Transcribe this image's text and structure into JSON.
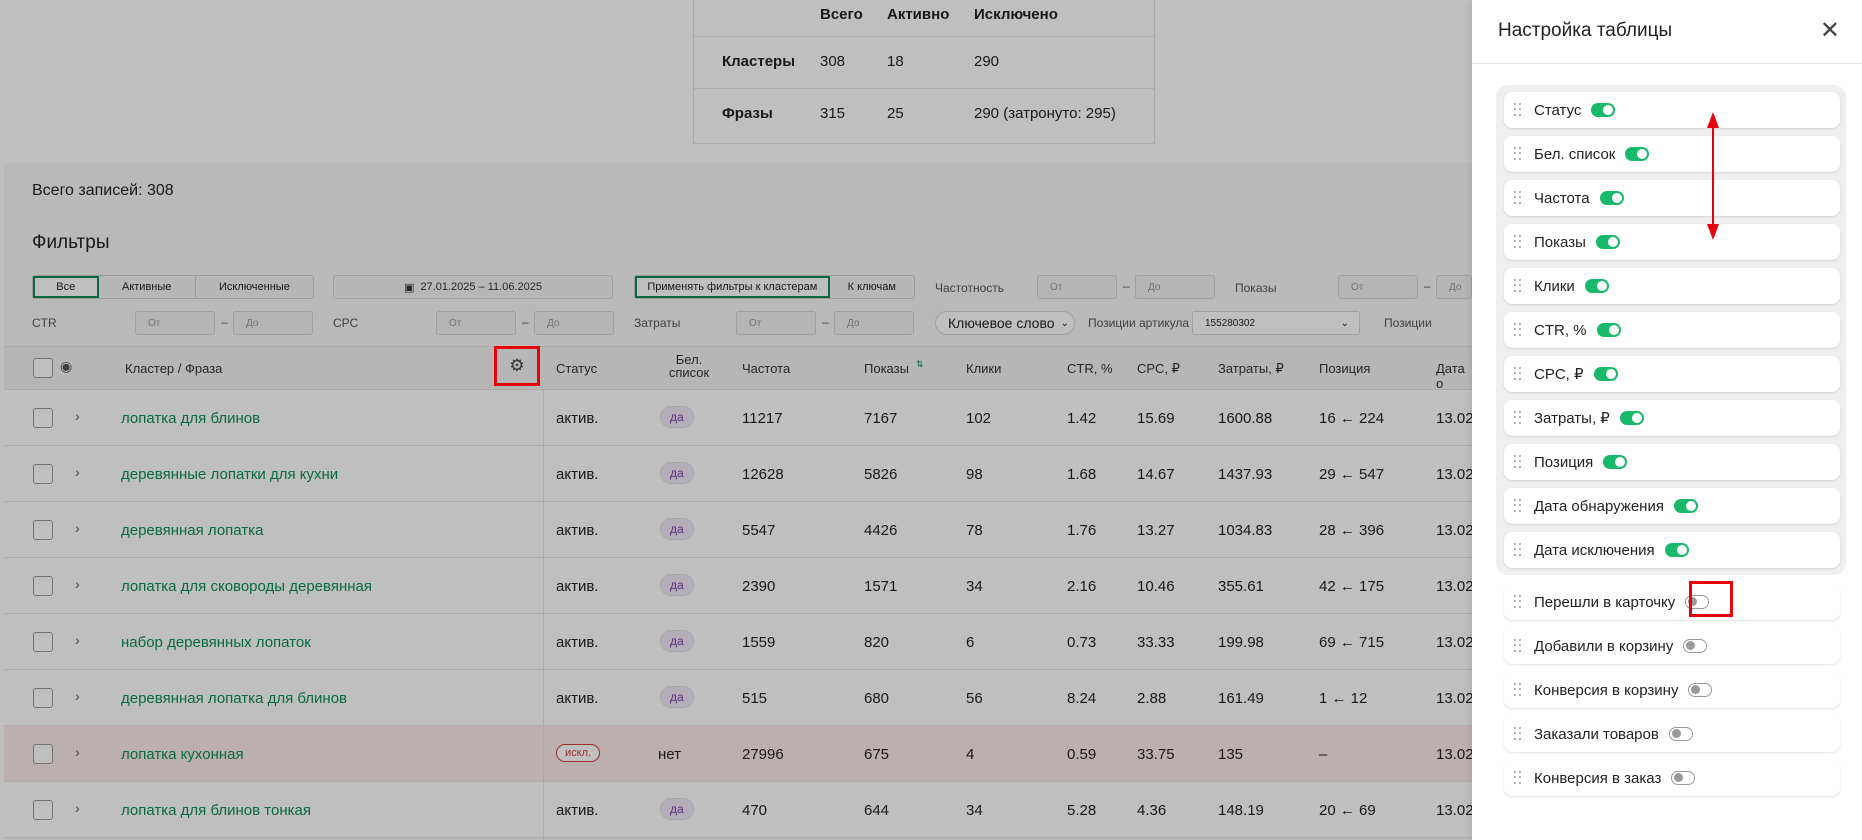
{
  "summary": {
    "headers": [
      "Всего",
      "Активно",
      "Исключено"
    ],
    "rows": [
      {
        "label": "Кластеры",
        "total": "308",
        "active": "18",
        "excluded": "290"
      },
      {
        "label": "Фразы",
        "total": "315",
        "active": "25",
        "excluded": "290 (затронуто: 295)"
      }
    ]
  },
  "records_label": "Всего записей: 308",
  "filters": {
    "title": "Фильтры",
    "status_segments": [
      "Все",
      "Активные",
      "Исключенные"
    ],
    "date_range": "27.01.2025 – 11.06.2025",
    "apply_segments": [
      "Применять фильтры к кластерам",
      "К ключам"
    ],
    "frequency_label": "Частотность",
    "shows_label": "Показы",
    "ctr_label": "CTR",
    "cpc_label": "CPC",
    "costs_label": "Затраты",
    "from_placeholder": "От",
    "to_placeholder": "До",
    "keyword_select": "Ключевое слово",
    "article_positions_label": "Позиции артикула",
    "article_value": "155280302",
    "positions_label": "Позиции"
  },
  "table": {
    "headers": {
      "cluster": "Кластер / Фраза",
      "status": "Статус",
      "whitelist": "Бел. список",
      "frequency": "Частота",
      "shows": "Показы",
      "clicks": "Клики",
      "ctr": "CTR, %",
      "cpc": "CPC, ₽",
      "costs": "Затраты, ₽",
      "position": "Позиция",
      "date": "Дата о"
    },
    "rows": [
      {
        "name": "лопатка для блинов",
        "status": "актив.",
        "white": "да",
        "freq": "11217",
        "shows": "7167",
        "clicks": "102",
        "ctr": "1.42",
        "cpc": "15.69",
        "costs": "1600.88",
        "pos": "16 ← 224",
        "date": "13.02",
        "excluded": false
      },
      {
        "name": "деревянные лопатки для кухни",
        "status": "актив.",
        "white": "да",
        "freq": "12628",
        "shows": "5826",
        "clicks": "98",
        "ctr": "1.68",
        "cpc": "14.67",
        "costs": "1437.93",
        "pos": "29 ← 547",
        "date": "13.02",
        "excluded": false
      },
      {
        "name": "деревянная лопатка",
        "status": "актив.",
        "white": "да",
        "freq": "5547",
        "shows": "4426",
        "clicks": "78",
        "ctr": "1.76",
        "cpc": "13.27",
        "costs": "1034.83",
        "pos": "28 ← 396",
        "date": "13.02",
        "excluded": false
      },
      {
        "name": "лопатка для сковороды деревянная",
        "status": "актив.",
        "white": "да",
        "freq": "2390",
        "shows": "1571",
        "clicks": "34",
        "ctr": "2.16",
        "cpc": "10.46",
        "costs": "355.61",
        "pos": "42 ← 175",
        "date": "13.02",
        "excluded": false
      },
      {
        "name": "набор деревянных лопаток",
        "status": "актив.",
        "white": "да",
        "freq": "1559",
        "shows": "820",
        "clicks": "6",
        "ctr": "0.73",
        "cpc": "33.33",
        "costs": "199.98",
        "pos": "69 ← 715",
        "date": "13.02",
        "excluded": false
      },
      {
        "name": "деревянная лопатка для блинов",
        "status": "актив.",
        "white": "да",
        "freq": "515",
        "shows": "680",
        "clicks": "56",
        "ctr": "8.24",
        "cpc": "2.88",
        "costs": "161.49",
        "pos": "1 ← 12",
        "date": "13.02",
        "excluded": false
      },
      {
        "name": "лопатка кухонная",
        "status": "искл.",
        "white": "нет",
        "freq": "27996",
        "shows": "675",
        "clicks": "4",
        "ctr": "0.59",
        "cpc": "33.75",
        "costs": "135",
        "pos": "–",
        "date": "13.02",
        "excluded": true
      },
      {
        "name": "лопатка для блинов тонкая",
        "status": "актив.",
        "white": "да",
        "freq": "470",
        "shows": "644",
        "clicks": "34",
        "ctr": "5.28",
        "cpc": "4.36",
        "costs": "148.19",
        "pos": "20 ← 69",
        "date": "13.02",
        "excluded": false
      }
    ]
  },
  "panel": {
    "title": "Настройка таблицы",
    "items": [
      {
        "label": "Статус",
        "on": true
      },
      {
        "label": "Бел. список",
        "on": true
      },
      {
        "label": "Частота",
        "on": true
      },
      {
        "label": "Показы",
        "on": true
      },
      {
        "label": "Клики",
        "on": true
      },
      {
        "label": "CTR, %",
        "on": true
      },
      {
        "label": "CPC, ₽",
        "on": true
      },
      {
        "label": "Затраты, ₽",
        "on": true
      },
      {
        "label": "Позиция",
        "on": true
      },
      {
        "label": "Дата обнаружения",
        "on": true
      },
      {
        "label": "Дата исключения",
        "on": true
      },
      {
        "label": "Перешли в карточку",
        "on": false
      },
      {
        "label": "Добавили в корзину",
        "on": false
      },
      {
        "label": "Конверсия в корзину",
        "on": false
      },
      {
        "label": "Заказали товаров",
        "on": false
      },
      {
        "label": "Конверсия в заказ",
        "on": false
      }
    ]
  },
  "colors": {
    "accent": "#0a8f55",
    "toggle_on": "#19b96b",
    "highlight": "#e8000b",
    "excluded_row": "#fbeaea"
  }
}
